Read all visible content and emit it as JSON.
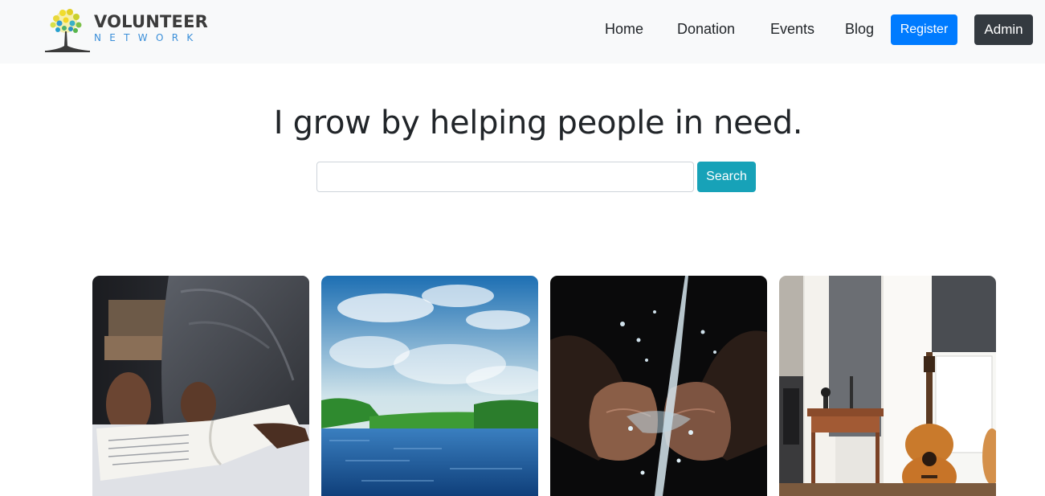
{
  "brand": {
    "title": "VOLUNTEER",
    "subtitle": "NETWORK",
    "logo_icon": "tree-logo-icon"
  },
  "nav": {
    "items": [
      {
        "label": "Home"
      },
      {
        "label": "Donation"
      },
      {
        "label": "Events"
      },
      {
        "label": "Blog"
      }
    ],
    "register_label": "Register",
    "admin_label": "Admin"
  },
  "hero": {
    "title": "I grow by helping people in need.",
    "search": {
      "value": "",
      "placeholder": "",
      "button_label": "Search"
    }
  },
  "cards": [
    {
      "image": "person-reading-book-photo"
    },
    {
      "image": "river-and-sky-photo"
    },
    {
      "image": "water-pouring-into-hands-photo"
    },
    {
      "image": "room-with-guitar-photo"
    }
  ],
  "colors": {
    "navbar_bg": "#f8f9fa",
    "register": "#007bff",
    "admin": "#343a40",
    "search": "#17a2b8",
    "brand_blue": "#3b8fd9"
  }
}
